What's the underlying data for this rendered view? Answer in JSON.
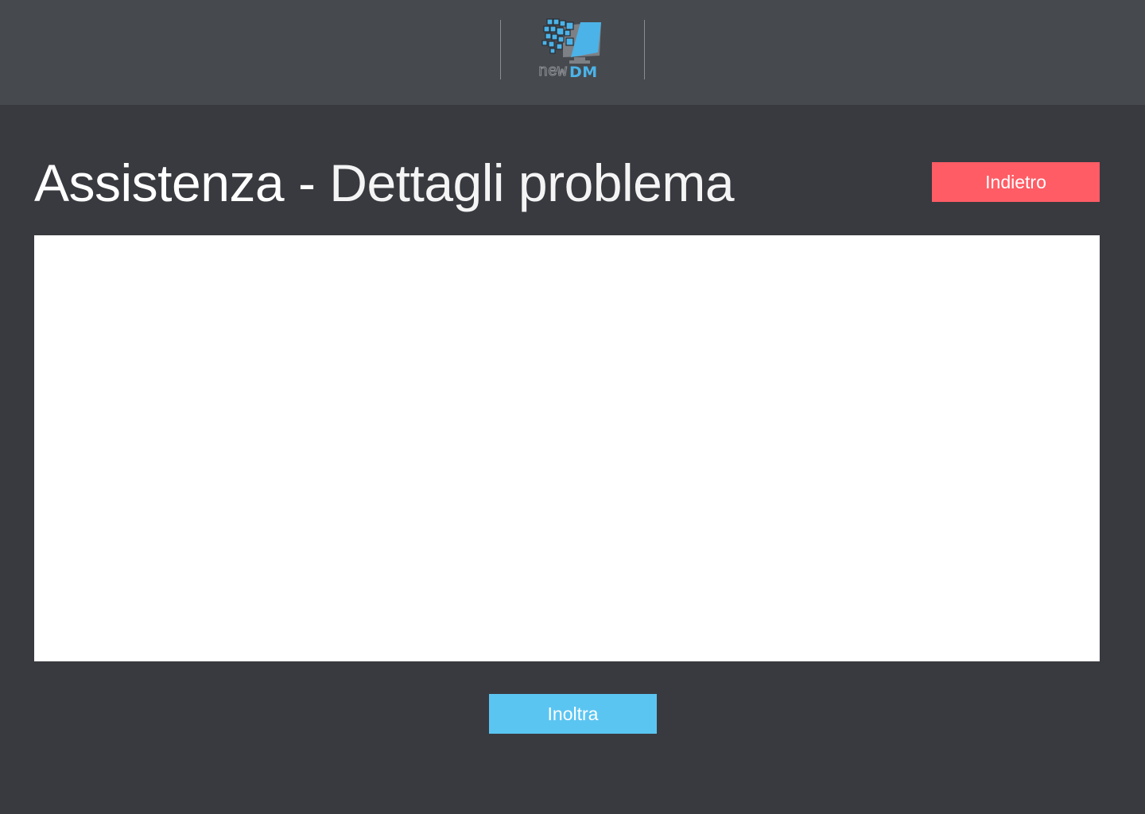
{
  "header": {
    "logo": {
      "icon": "monitor-pixels-icon",
      "text_light": "new",
      "text_bold": "DM",
      "colors": {
        "accent": "#4bb3e8",
        "monitor": "#7a7d82"
      }
    }
  },
  "page": {
    "title_main": "Assistenza - ",
    "title_sub": "Dettagli problema"
  },
  "actions": {
    "back_label": "Indietro",
    "forward_label": "Inoltra"
  },
  "form": {
    "details_value": "",
    "details_placeholder": ""
  },
  "colors": {
    "background": "#393a3f",
    "header": "#46494e",
    "back_button": "#ff5c65",
    "forward_button": "#5bc5f2",
    "text": "#ffffff"
  }
}
